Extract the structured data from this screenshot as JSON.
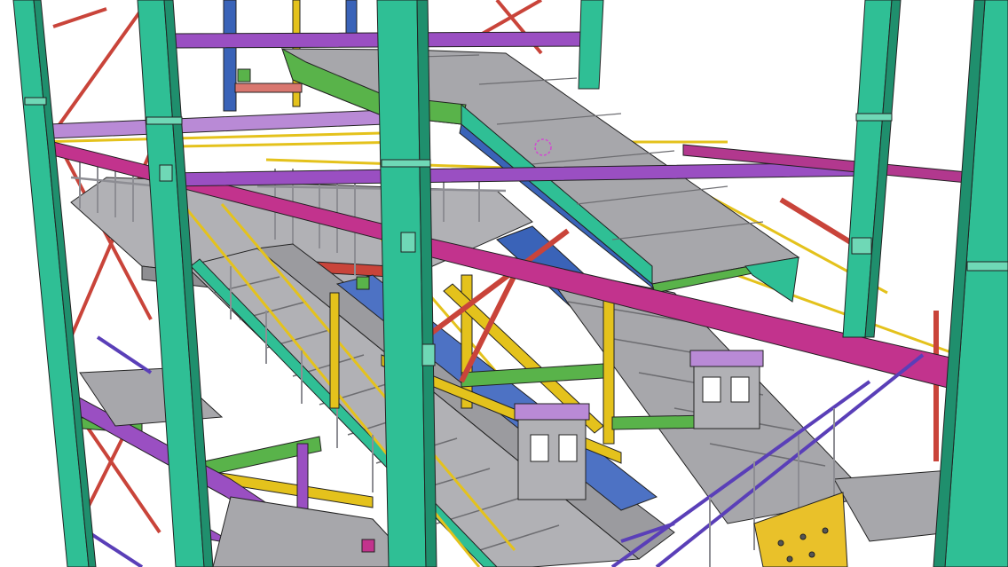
{
  "scene": {
    "subject": "steel-structure-3d-model",
    "colors": {
      "background": "#ffffff",
      "column": "#2fbf95",
      "column_dark": "#1f8f6d",
      "purple_beam": "#9a4fc2",
      "magenta_beam": "#c2338d",
      "yellow_member": "#e4c21c",
      "stair_grey": "#a7a7ab",
      "stair_grey_dark": "#7c7c80",
      "blue_stringer": "#3a63b8",
      "green_brace": "#59b34a",
      "red_brace": "#c9443a",
      "orange_plate": "#e9c12a",
      "railing": "#8d8d93",
      "outline": "#222222"
    }
  }
}
